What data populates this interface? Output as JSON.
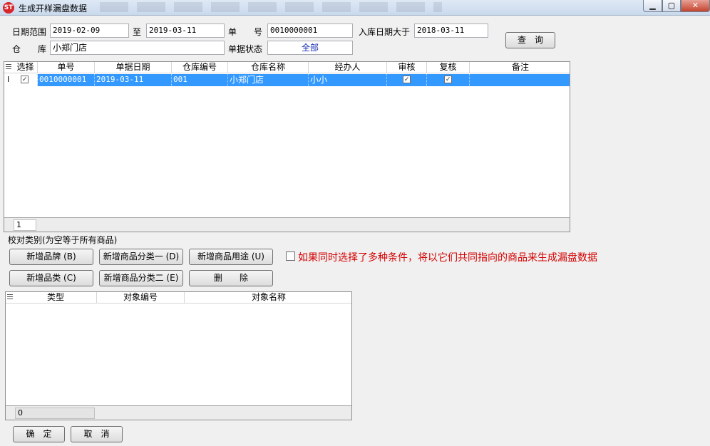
{
  "window": {
    "title": "生成开样漏盘数据",
    "icon_name": "app-logo-icon"
  },
  "filters": {
    "date_range_label": "日期范围",
    "date_from": "2019-02-09",
    "to_label": "至",
    "date_to": "2019-03-11",
    "doc_no_label": "单　　号",
    "doc_no": "0010000001",
    "inbound_after_label": "入库日期大于",
    "inbound_after": "2018-03-11",
    "warehouse_label": "仓　　库",
    "warehouse": "小郑门店",
    "status_label": "单据状态",
    "status": "全部",
    "query_button": "查　询"
  },
  "doc_grid": {
    "columns": [
      "选择",
      "单号",
      "单据日期",
      "仓库编号",
      "仓库名称",
      "经办人",
      "审核",
      "复核",
      "备注"
    ],
    "rows": [
      {
        "marker": "I",
        "selected": true,
        "doc_no": "0010000001",
        "date": "2019-03-11",
        "warehouse_code": "001",
        "warehouse_name": "小郑门店",
        "handler": "小小",
        "audited": true,
        "rechecked": true,
        "remark": ""
      }
    ],
    "footer_count": "1"
  },
  "category_section": {
    "label": "校对类别(为空等于所有商品)",
    "buttons": {
      "add_brand": "新增品牌 (B)",
      "add_category1": "新增商品分类一 (D)",
      "add_usage": "新增商品用途 (U)",
      "add_type": "新增品类 (C)",
      "add_category2": "新增商品分类二 (E)",
      "delete": "删　　除"
    },
    "combine_hint": "如果同时选择了多种条件，将以它们共同指向的商品来生成漏盘数据"
  },
  "object_grid": {
    "columns": [
      "类型",
      "对象编号",
      "对象名称"
    ],
    "footer_count": "0"
  },
  "actions": {
    "confirm": "确　定",
    "cancel": "取　消"
  }
}
